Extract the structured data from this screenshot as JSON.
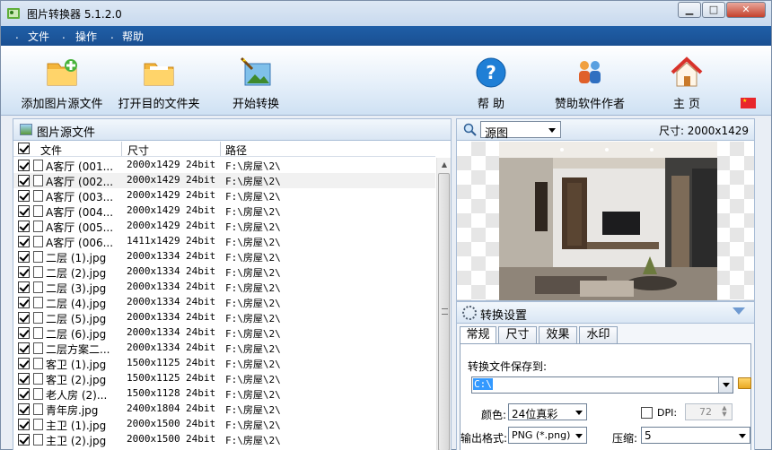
{
  "window": {
    "title": "图片转换器 5.1.2.0",
    "min": "▁",
    "max": "□",
    "close": "✕"
  },
  "menu": [
    {
      "label": "文件"
    },
    {
      "label": "操作"
    },
    {
      "label": "帮助"
    }
  ],
  "toolbar": {
    "add_source": "添加图片源文件",
    "open_dest": "打开目的文件夹",
    "start": "开始转换",
    "help": "帮 助",
    "sponsor": "赞助软件作者",
    "home": "主 页"
  },
  "flag": "★",
  "files_panel": {
    "title": "图片源文件",
    "columns": {
      "name": "文件",
      "size": "尺寸",
      "path": "路径"
    },
    "rows": [
      {
        "name": "A客厅 (001...",
        "size": "2000x1429",
        "depth": "24bit",
        "path": "F:\\房屋\\2\\"
      },
      {
        "name": "A客厅 (002...",
        "size": "2000x1429",
        "depth": "24bit",
        "path": "F:\\房屋\\2\\"
      },
      {
        "name": "A客厅 (003...",
        "size": "2000x1429",
        "depth": "24bit",
        "path": "F:\\房屋\\2\\"
      },
      {
        "name": "A客厅 (004...",
        "size": "2000x1429",
        "depth": "24bit",
        "path": "F:\\房屋\\2\\"
      },
      {
        "name": "A客厅 (005...",
        "size": "2000x1429",
        "depth": "24bit",
        "path": "F:\\房屋\\2\\"
      },
      {
        "name": "A客厅 (006...",
        "size": "1411x1429",
        "depth": "24bit",
        "path": "F:\\房屋\\2\\"
      },
      {
        "name": "二层 (1).jpg",
        "size": "2000x1334",
        "depth": "24bit",
        "path": "F:\\房屋\\2\\"
      },
      {
        "name": "二层 (2).jpg",
        "size": "2000x1334",
        "depth": "24bit",
        "path": "F:\\房屋\\2\\"
      },
      {
        "name": "二层 (3).jpg",
        "size": "2000x1334",
        "depth": "24bit",
        "path": "F:\\房屋\\2\\"
      },
      {
        "name": "二层 (4).jpg",
        "size": "2000x1334",
        "depth": "24bit",
        "path": "F:\\房屋\\2\\"
      },
      {
        "name": "二层 (5).jpg",
        "size": "2000x1334",
        "depth": "24bit",
        "path": "F:\\房屋\\2\\"
      },
      {
        "name": "二层 (6).jpg",
        "size": "2000x1334",
        "depth": "24bit",
        "path": "F:\\房屋\\2\\"
      },
      {
        "name": "二层方案二...",
        "size": "2000x1334",
        "depth": "24bit",
        "path": "F:\\房屋\\2\\"
      },
      {
        "name": "客卫 (1).jpg",
        "size": "1500x1125",
        "depth": "24bit",
        "path": "F:\\房屋\\2\\"
      },
      {
        "name": "客卫 (2).jpg",
        "size": "1500x1125",
        "depth": "24bit",
        "path": "F:\\房屋\\2\\"
      },
      {
        "name": "老人房 (2)...",
        "size": "1500x1128",
        "depth": "24bit",
        "path": "F:\\房屋\\2\\"
      },
      {
        "name": "青年房.jpg",
        "size": "2400x1804",
        "depth": "24bit",
        "path": "F:\\房屋\\2\\"
      },
      {
        "name": "主卫 (1).jpg",
        "size": "2000x1500",
        "depth": "24bit",
        "path": "F:\\房屋\\2\\"
      },
      {
        "name": "主卫 (2).jpg",
        "size": "2000x1500",
        "depth": "24bit",
        "path": "F:\\房屋\\2\\"
      }
    ]
  },
  "preview": {
    "mode": "源图",
    "size_label": "尺寸: 2000x1429"
  },
  "settings": {
    "title": "转换设置",
    "tabs": [
      "常规",
      "尺寸",
      "效果",
      "水印"
    ],
    "save_to_label": "转换文件保存到:",
    "save_to_value": "C:\\",
    "color_label": "颜色:",
    "color_value": "24位真彩",
    "dpi_label": "DPI:",
    "dpi_value": "72",
    "format_label": "输出格式:",
    "format_value": "PNG (*.png)",
    "compress_label": "压缩:",
    "compress_value": "5"
  }
}
